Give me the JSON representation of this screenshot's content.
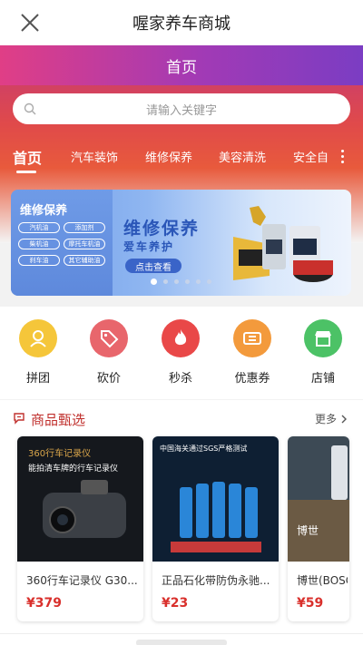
{
  "app": {
    "title": "喔家养车商城"
  },
  "header": {
    "band_title": "首页"
  },
  "search": {
    "placeholder": "请输入关键字"
  },
  "tabs": [
    "首页",
    "汽车装饰",
    "维修保养",
    "美容清洗",
    "安全自"
  ],
  "banner": {
    "left_title": "维修保养",
    "pills": [
      "汽机油",
      "添加剂",
      "柴机油",
      "摩托车机油",
      "刹车油",
      "其它辅助油"
    ],
    "main_title": "维修保养",
    "subtitle": "爱车养护",
    "button": "点击查看",
    "slide_count": 6,
    "active_slide": 1
  },
  "quick_actions": [
    {
      "label": "拼团",
      "icon": "group-buy-icon",
      "color": "#f5c63a"
    },
    {
      "label": "砍价",
      "icon": "bargain-tag-icon",
      "color": "#e8666c"
    },
    {
      "label": "秒杀",
      "icon": "flame-icon",
      "color": "#e94848"
    },
    {
      "label": "优惠券",
      "icon": "coupon-icon",
      "color": "#f39a3c"
    },
    {
      "label": "店铺",
      "icon": "store-icon",
      "color": "#4cc266"
    }
  ],
  "section": {
    "title": "商品甄选",
    "more": "更多"
  },
  "products": [
    {
      "name": "360行车记录仪 G30...",
      "price": "¥379",
      "img_text_1": "360行车记录仪",
      "img_text_2": "能拍清车牌的行车记录仪"
    },
    {
      "name": "正品石化带防伪永驰...",
      "price": "¥23",
      "img_text_1": "中国海关通过SGS严格测试"
    },
    {
      "name": "博世(BOSC",
      "price": "¥59",
      "img_text_1": "博世"
    }
  ],
  "colors": {
    "accent": "#d9302c",
    "brand_band_start": "#e03e86",
    "brand_band_end": "#7b3dc3"
  }
}
